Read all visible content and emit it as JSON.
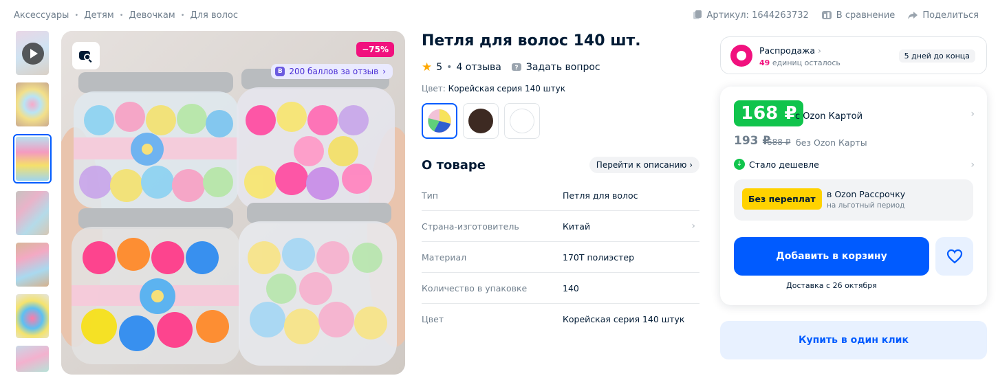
{
  "breadcrumbs": [
    "Аксессуары",
    "Детям",
    "Девочкам",
    "Для волос"
  ],
  "top_actions": {
    "article": "Артикул: 1644263732",
    "compare": "В сравнение",
    "share": "Поделиться"
  },
  "gallery": {
    "thumbnail_count": 7,
    "active_index": 2,
    "discount_badge": "−75%",
    "points_badge": "200 баллов за отзыв"
  },
  "product": {
    "title": "Петля для волос 140 шт.",
    "rating": "5",
    "reviews": "4 отзыва",
    "ask_question": "Задать вопрос",
    "color_label": "Цвет:",
    "color_value": "Корейская серия 140 штук",
    "swatches": [
      {
        "name": "multicolor",
        "color": "#f2c2d8"
      },
      {
        "name": "brown",
        "color": "#3d2a22"
      },
      {
        "name": "white",
        "color": "#ffffff"
      }
    ]
  },
  "about": {
    "title": "О товаре",
    "goto_description": "Перейти к описанию",
    "specs": [
      {
        "key": "Тип",
        "value": "Петля для волос"
      },
      {
        "key": "Страна-изготовитель",
        "value": "Китай"
      },
      {
        "key": "Материал",
        "value": "170Т полиэстер"
      },
      {
        "key": "Количество в упаковке",
        "value": "140"
      },
      {
        "key": "Цвет",
        "value": "Корейская серия 140 штук"
      }
    ]
  },
  "sale": {
    "title": "Распродажа",
    "remaining_count": "49",
    "remaining_text": "единиц осталось",
    "days_left": "5 дней до конца"
  },
  "buybox": {
    "price_card": "168 ₽",
    "price_card_label": "с Ozon Картой",
    "price_regular": "193 ₽",
    "price_old": "688 ₽",
    "price_regular_label": "без Ozon Карты",
    "cheaper": "Стало дешевле",
    "installment_tag": "Без переплат",
    "installment_line1": "в Ozon Рассрочку",
    "installment_line2": "на льготный период",
    "add_to_cart": "Добавить в корзину",
    "delivery": "Доставка с 26 октября",
    "one_click": "Купить в один клик"
  },
  "colors": {
    "accent": "#005bff",
    "price_green": "#10c44c",
    "sale_pink": "#f1117e",
    "installment_yellow": "#ffd200"
  }
}
